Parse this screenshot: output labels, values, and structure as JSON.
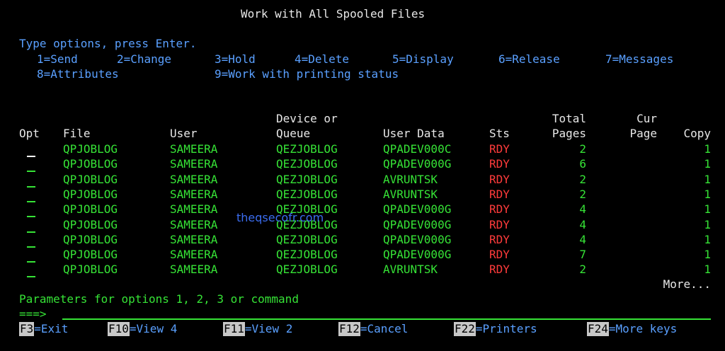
{
  "screen": {
    "title": "Work with All Spooled Files",
    "instruction": "Type options, press Enter.",
    "options_row1": [
      "1=Send",
      "2=Change",
      "3=Hold",
      "4=Delete",
      "5=Display",
      "6=Release",
      "7=Messages"
    ],
    "options_row2": [
      "8=Attributes",
      "9=Work with printing status"
    ]
  },
  "table": {
    "headers_top": {
      "queue": "Device or",
      "total": "Total",
      "cur": "Cur"
    },
    "headers": {
      "opt": "Opt",
      "file": "File",
      "user": "User",
      "queue": "Queue",
      "userdata": "User Data",
      "sts": "Sts",
      "total": "Pages",
      "cur": "Page",
      "copy": "Copy"
    },
    "rows": [
      {
        "file": "QPJOBLOG",
        "user": "SAMEERA",
        "queue": "QEZJOBLOG",
        "userdata": "QPADEV000C",
        "sts": "RDY",
        "pages": "2",
        "copy": "1"
      },
      {
        "file": "QPJOBLOG",
        "user": "SAMEERA",
        "queue": "QEZJOBLOG",
        "userdata": "QPADEV000G",
        "sts": "RDY",
        "pages": "6",
        "copy": "1"
      },
      {
        "file": "QPJOBLOG",
        "user": "SAMEERA",
        "queue": "QEZJOBLOG",
        "userdata": "AVRUNTSK",
        "sts": "RDY",
        "pages": "2",
        "copy": "1"
      },
      {
        "file": "QPJOBLOG",
        "user": "SAMEERA",
        "queue": "QEZJOBLOG",
        "userdata": "AVRUNTSK",
        "sts": "RDY",
        "pages": "2",
        "copy": "1"
      },
      {
        "file": "QPJOBLOG",
        "user": "SAMEERA",
        "queue": "QEZJOBLOG",
        "userdata": "QPADEV000G",
        "sts": "RDY",
        "pages": "4",
        "copy": "1"
      },
      {
        "file": "QPJOBLOG",
        "user": "SAMEERA",
        "queue": "QEZJOBLOG",
        "userdata": "QPADEV000G",
        "sts": "RDY",
        "pages": "4",
        "copy": "1"
      },
      {
        "file": "QPJOBLOG",
        "user": "SAMEERA",
        "queue": "QEZJOBLOG",
        "userdata": "QPADEV000G",
        "sts": "RDY",
        "pages": "4",
        "copy": "1"
      },
      {
        "file": "QPJOBLOG",
        "user": "SAMEERA",
        "queue": "QEZJOBLOG",
        "userdata": "QPADEV000G",
        "sts": "RDY",
        "pages": "7",
        "copy": "1"
      },
      {
        "file": "QPJOBLOG",
        "user": "SAMEERA",
        "queue": "QEZJOBLOG",
        "userdata": "AVRUNTSK",
        "sts": "RDY",
        "pages": "2",
        "copy": "1"
      }
    ],
    "more": "More..."
  },
  "command": {
    "prompt_label": "Parameters for options 1, 2, 3 or command",
    "arrow": "===>",
    "value": ""
  },
  "fkeys": [
    {
      "key": "F3",
      "label": "=Exit"
    },
    {
      "key": "F10",
      "label": "=View 4"
    },
    {
      "key": "F11",
      "label": "=View 2"
    },
    {
      "key": "F12",
      "label": "=Cancel"
    },
    {
      "key": "F22",
      "label": "=Printers"
    },
    {
      "key": "F24",
      "label": "=More keys"
    }
  ],
  "watermark": "theqsecofr.com",
  "colors": {
    "background": "#000000",
    "field_text": "#36e336",
    "help_text": "#5aa0ff",
    "status": "#ff3b3b",
    "header": "#e8e8e8"
  }
}
